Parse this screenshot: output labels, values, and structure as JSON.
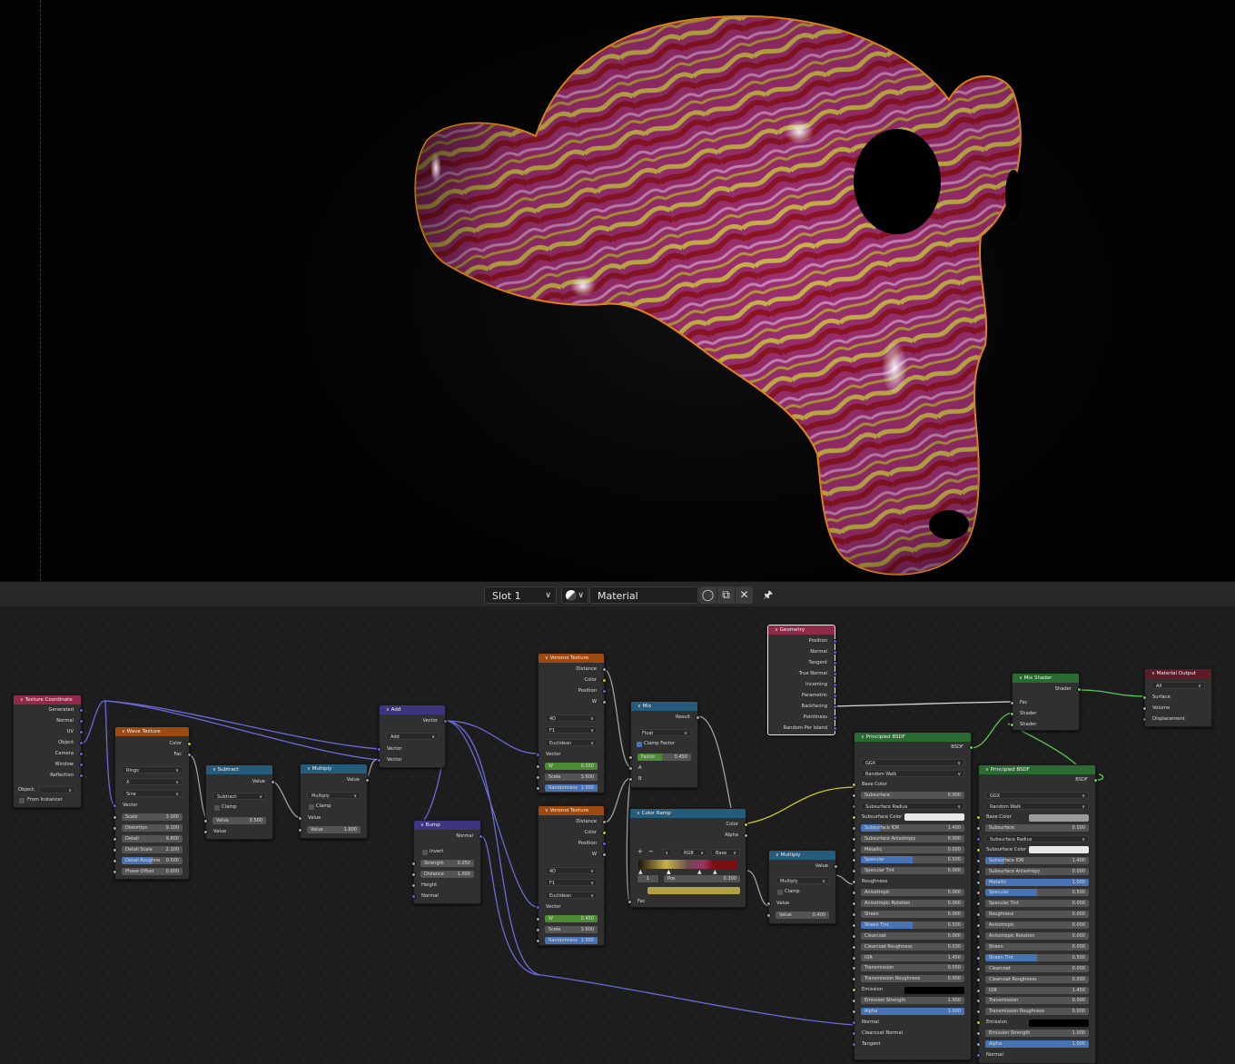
{
  "viewport": {
    "background": "#050505",
    "outline": "#e8891b",
    "mesh_colors": [
      "#9d2f6e",
      "#c8b24a",
      "#8e1525"
    ]
  },
  "header": {
    "slot": "Slot 1",
    "material": "Material"
  },
  "nodes": {
    "texcoord": {
      "title": "Texture Coordinate",
      "outputs": [
        "Generated",
        "Normal",
        "UV",
        "Object",
        "Camera",
        "Window",
        "Reflection"
      ],
      "object_label": "Object:",
      "from_instancer": "From Instancer"
    },
    "wave": {
      "title": "Wave Texture",
      "outputs": [
        "Color",
        "Fac"
      ],
      "type": "Rings",
      "direction": "X",
      "profile": "Sine",
      "vector": "Vector",
      "fields": [
        {
          "label": "Scale",
          "value": "3.000"
        },
        {
          "label": "Distortion",
          "value": "9.100"
        },
        {
          "label": "Detail",
          "value": "9.800"
        },
        {
          "label": "Detail Scale",
          "value": "2.100"
        },
        {
          "label": "Detail Roughne",
          "value": "0.500"
        },
        {
          "label": "Phase Offset",
          "value": "0.000"
        }
      ]
    },
    "subtract": {
      "title": "Subtract",
      "output": "Value",
      "op": "Subtract",
      "clamp": "Clamp",
      "field_label": "Value",
      "field_value": "0.500",
      "input": "Value"
    },
    "multiply1": {
      "title": "Multiply",
      "output": "Value",
      "op": "Multiply",
      "clamp": "Clamp",
      "input": "Value",
      "field_label": "Value",
      "field_value": "1.800"
    },
    "add": {
      "title": "Add",
      "output": "Vector",
      "op": "Add",
      "in1": "Vector",
      "in2": "Vector"
    },
    "bump": {
      "title": "Bump",
      "output": "Normal",
      "invert": "Invert",
      "strength_label": "Strength",
      "strength": "0.050",
      "distance_label": "Distance",
      "distance": "1.000",
      "height": "Height",
      "normal": "Normal"
    },
    "voronoi1": {
      "title": "Voronoi Texture",
      "outputs": [
        "Distance",
        "Color",
        "Position",
        "W"
      ],
      "dim": "4D",
      "feature": "F1",
      "metric": "Euclidean",
      "vector": "Vector",
      "w_label": "W",
      "w": "0.550",
      "scale_label": "Scale",
      "scale": "3.600",
      "rand_label": "Randomness",
      "rand": "1.000"
    },
    "voronoi2": {
      "title": "Voronoi Texture",
      "outputs": [
        "Distance",
        "Color",
        "Position",
        "W"
      ],
      "dim": "4D",
      "feature": "F1",
      "metric": "Euclidean",
      "vector": "Vector",
      "w_label": "W",
      "w": "0.450",
      "scale_label": "Scale",
      "scale": "3.600",
      "rand_label": "Randomness",
      "rand": "1.000"
    },
    "mix": {
      "title": "Mix",
      "output": "Result",
      "type": "Float",
      "clamp": "Clamp Factor",
      "factor_label": "Factor",
      "factor": "0.450",
      "a": "A",
      "b": "B"
    },
    "colorramp": {
      "title": "Color Ramp",
      "outputs": [
        "Color",
        "Alpha"
      ],
      "plus": "+",
      "minus": "−",
      "mode": "RGB",
      "interp": "Base",
      "index": "1",
      "pos_label": "Pos",
      "pos": "0.300",
      "fac": "Fac"
    },
    "geometry": {
      "title": "Geometry",
      "outputs": [
        "Position",
        "Normal",
        "Tangent",
        "True Normal",
        "Incoming",
        "Parametric",
        "Backfacing",
        "Pointiness",
        "Random Per Island"
      ]
    },
    "multiply2": {
      "title": "Multiply",
      "output": "Value",
      "op": "Multiply",
      "clamp": "Clamp",
      "input": "Value",
      "field_label": "Value",
      "field_value": "0.400"
    },
    "mixshader": {
      "title": "Mix Shader",
      "output": "Shader",
      "inputs": [
        "Fac",
        "Shader",
        "Shader"
      ]
    },
    "matout": {
      "title": "Material Output",
      "target": "All",
      "inputs": [
        "Surface",
        "Volume",
        "Displacement"
      ]
    },
    "bsdf1": {
      "title": "Principled BSDF",
      "output": "BSDF",
      "dist": "GGX",
      "sss": "Random Walk",
      "base_color": "Base Color",
      "fields": [
        {
          "label": "Subsurface",
          "value": "0.000"
        },
        {
          "label": "Subsurface Radius",
          "value": ""
        },
        {
          "label": "Subsurface Color",
          "value": ""
        },
        {
          "label": "Subsurface IOR",
          "value": "1.400"
        },
        {
          "label": "Subsurface Anisotropy",
          "value": "0.000"
        },
        {
          "label": "Metallic",
          "value": "0.000"
        },
        {
          "label": "Specular",
          "value": "0.500"
        },
        {
          "label": "Specular Tint",
          "value": "0.000"
        },
        {
          "label": "Roughness",
          "value": ""
        },
        {
          "label": "Anisotropic",
          "value": "0.000"
        },
        {
          "label": "Anisotropic Rotation",
          "value": "0.000"
        },
        {
          "label": "Sheen",
          "value": "0.000"
        },
        {
          "label": "Sheen Tint",
          "value": "0.500"
        },
        {
          "label": "Clearcoat",
          "value": "0.000"
        },
        {
          "label": "Clearcoat Roughness",
          "value": "0.030"
        },
        {
          "label": "IOR",
          "value": "1.450"
        },
        {
          "label": "Transmission",
          "value": "0.000"
        },
        {
          "label": "Transmission Roughness",
          "value": "0.000"
        },
        {
          "label": "Emission",
          "value": ""
        },
        {
          "label": "Emission Strength",
          "value": "1.000"
        },
        {
          "label": "Alpha",
          "value": "1.000"
        }
      ],
      "tail": [
        "Normal",
        "Clearcoat Normal",
        "Tangent"
      ]
    },
    "bsdf2": {
      "title": "Principled BSDF",
      "output": "BSDF",
      "dist": "GGX",
      "sss": "Random Walk",
      "base_color": "Base Color",
      "fields": [
        {
          "label": "Subsurface",
          "value": "0.000"
        },
        {
          "label": "Subsurface Radius",
          "value": ""
        },
        {
          "label": "Subsurface Color",
          "value": ""
        },
        {
          "label": "Subsurface IOR",
          "value": "1.400"
        },
        {
          "label": "Subsurface Anisotropy",
          "value": "0.000"
        },
        {
          "label": "Metallic",
          "value": "1.000"
        },
        {
          "label": "Specular",
          "value": "0.500"
        },
        {
          "label": "Specular Tint",
          "value": "0.000"
        },
        {
          "label": "Roughness",
          "value": "0.000"
        },
        {
          "label": "Anisotropic",
          "value": "0.000"
        },
        {
          "label": "Anisotropic Rotation",
          "value": "0.000"
        },
        {
          "label": "Sheen",
          "value": "0.000"
        },
        {
          "label": "Sheen Tint",
          "value": "0.500"
        },
        {
          "label": "Clearcoat",
          "value": "0.000"
        },
        {
          "label": "Clearcoat Roughness",
          "value": "0.030"
        },
        {
          "label": "IOR",
          "value": "1.450"
        },
        {
          "label": "Transmission",
          "value": "0.000"
        },
        {
          "label": "Transmission Roughness",
          "value": "0.000"
        },
        {
          "label": "Emission",
          "value": ""
        },
        {
          "label": "Emission Strength",
          "value": "1.000"
        },
        {
          "label": "Alpha",
          "value": "1.000"
        }
      ],
      "tail": [
        "Normal"
      ]
    }
  }
}
